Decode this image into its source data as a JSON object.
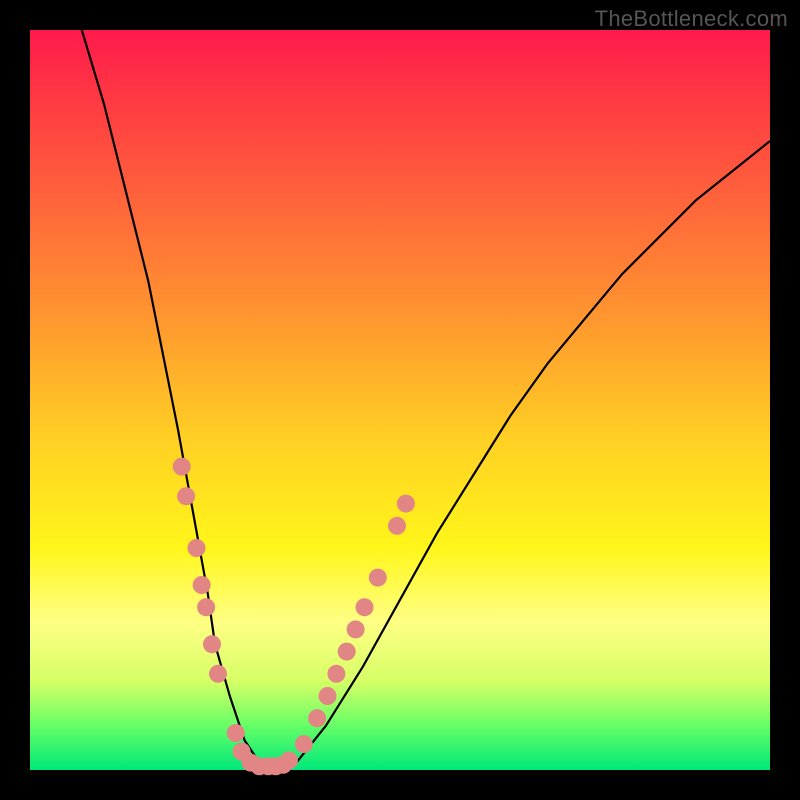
{
  "attribution": "TheBottleneck.com",
  "chart_data": {
    "type": "line",
    "title": "",
    "xlabel": "",
    "ylabel": "",
    "xlim": [
      0,
      100
    ],
    "ylim": [
      0,
      100
    ],
    "series": [
      {
        "name": "bottleneck-curve",
        "x": [
          7,
          10,
          13,
          16,
          18,
          20,
          22,
          24,
          25,
          27,
          29,
          31,
          33,
          36,
          40,
          45,
          50,
          55,
          60,
          65,
          70,
          75,
          80,
          85,
          90,
          95,
          100
        ],
        "values": [
          100,
          90,
          78,
          66,
          56,
          46,
          35,
          24,
          17,
          10,
          4,
          1,
          0,
          1,
          6,
          14,
          23,
          32,
          40,
          48,
          55,
          61,
          67,
          72,
          77,
          81,
          85
        ]
      }
    ],
    "markers": {
      "name": "sample-dots",
      "color": "#e28585",
      "points": [
        {
          "x": 20.5,
          "y": 41
        },
        {
          "x": 21.1,
          "y": 37
        },
        {
          "x": 22.5,
          "y": 30
        },
        {
          "x": 23.2,
          "y": 25
        },
        {
          "x": 23.8,
          "y": 22
        },
        {
          "x": 24.6,
          "y": 17
        },
        {
          "x": 25.4,
          "y": 13
        },
        {
          "x": 27.8,
          "y": 5
        },
        {
          "x": 28.6,
          "y": 2.5
        },
        {
          "x": 29.8,
          "y": 1
        },
        {
          "x": 31.0,
          "y": 0.5
        },
        {
          "x": 32.2,
          "y": 0.5
        },
        {
          "x": 33.2,
          "y": 0.5
        },
        {
          "x": 34.2,
          "y": 0.7
        },
        {
          "x": 35.0,
          "y": 1.3
        },
        {
          "x": 37.0,
          "y": 3.5
        },
        {
          "x": 38.8,
          "y": 7
        },
        {
          "x": 40.2,
          "y": 10
        },
        {
          "x": 41.4,
          "y": 13
        },
        {
          "x": 42.8,
          "y": 16
        },
        {
          "x": 44.0,
          "y": 19
        },
        {
          "x": 45.2,
          "y": 22
        },
        {
          "x": 47.0,
          "y": 26
        },
        {
          "x": 49.6,
          "y": 33
        },
        {
          "x": 50.8,
          "y": 36
        }
      ]
    },
    "green_band": {
      "y0": 0,
      "y1": 5
    }
  }
}
